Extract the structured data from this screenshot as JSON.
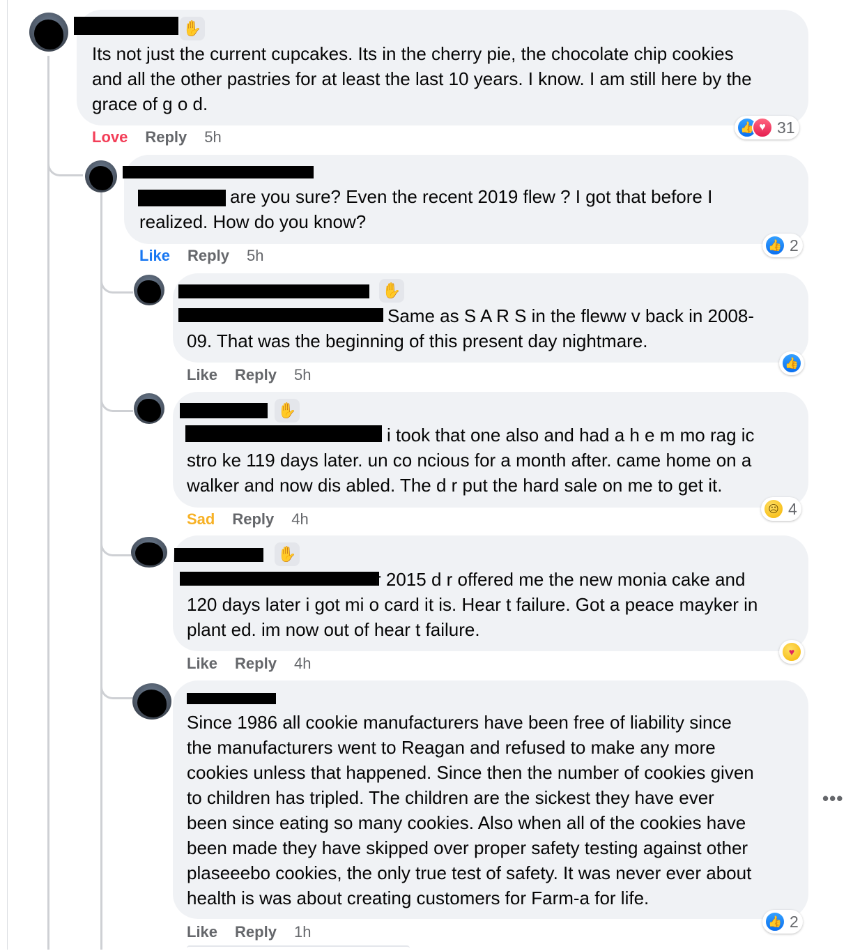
{
  "comments": [
    {
      "lines": [
        "Its not just the current cupcakes. Its in the cherry pie, the chocolate chip cookies",
        "and all the other pastries for at least the last 10 years. I know. I am still here by the",
        "grace of g o d."
      ],
      "actions": {
        "react": "Love",
        "reply": "Reply",
        "time": "5h"
      },
      "reactions": {
        "icons": [
          "like",
          "love"
        ],
        "count": "31"
      }
    },
    {
      "lines": [
        "are you sure? Even the recent 2019 flew ? I got that before I",
        "realized. How do you know?"
      ],
      "actions": {
        "react": "Like",
        "reply": "Reply",
        "time": "5h"
      },
      "reactions": {
        "icons": [
          "like"
        ],
        "count": "2"
      }
    },
    {
      "lines": [
        "Same as S A R S in the fleww v back in 2008-",
        "09. That was the beginning of this present day nightmare."
      ],
      "actions": {
        "react": "Like",
        "reply": "Reply",
        "time": "5h"
      },
      "reactions": {
        "icons": [
          "like"
        ],
        "count": ""
      }
    },
    {
      "lines": [
        "i took that one also and had a h e m mo rag ic",
        "stro ke 119 days later. un co ncious for a month after. came home on a",
        "walker and now dis abled. The d r put the hard sale on me to get it."
      ],
      "actions": {
        "react": "Sad",
        "reply": "Reply",
        "time": "4h"
      },
      "reactions": {
        "icons": [
          "sad"
        ],
        "count": "4"
      }
    },
    {
      "lines": [
        "r 2015 d r offered me the new monia cake and",
        "120 days later i got mi o card it is. Hear t failure. Got a peace mayker in",
        "plant ed. im now out of hear t failure."
      ],
      "actions": {
        "react": "Like",
        "reply": "Reply",
        "time": "4h"
      },
      "reactions": {
        "icons": [
          "care"
        ],
        "count": ""
      }
    },
    {
      "lines": [
        "Since 1986 all cookie manufacturers have been free of liability since",
        "the manufacturers went to Reagan and refused to make any more",
        "cookies unless that happened. Since then the number of cookies given",
        "to children has tripled. The children are the sickest they have ever",
        "been since eating so many cookies. Also when all of the cookies have",
        "been made they have skipped over proper safety testing against other",
        "plaseeebo cookies, the only true test of safety. It was never ever about",
        "health is was about creating customers for Farm-a for life."
      ],
      "actions": {
        "react": "Like",
        "reply": "Reply",
        "time": "1h"
      },
      "reactions": {
        "icons": [
          "like"
        ],
        "count": "2"
      }
    }
  ],
  "icons": {
    "wave_badge": "wave-badge-icon",
    "like": "thumbs-up-icon",
    "love": "heart-icon",
    "sad": "sad-face-icon",
    "care": "care-face-icon",
    "more": "more-options-icon"
  },
  "more_glyph": "•••",
  "colors": {
    "bubble": "#f0f2f5",
    "like_blue": "#1877f2",
    "love_red": "#f33e58",
    "sad_yellow": "#f7b125",
    "muted": "#65676b"
  }
}
